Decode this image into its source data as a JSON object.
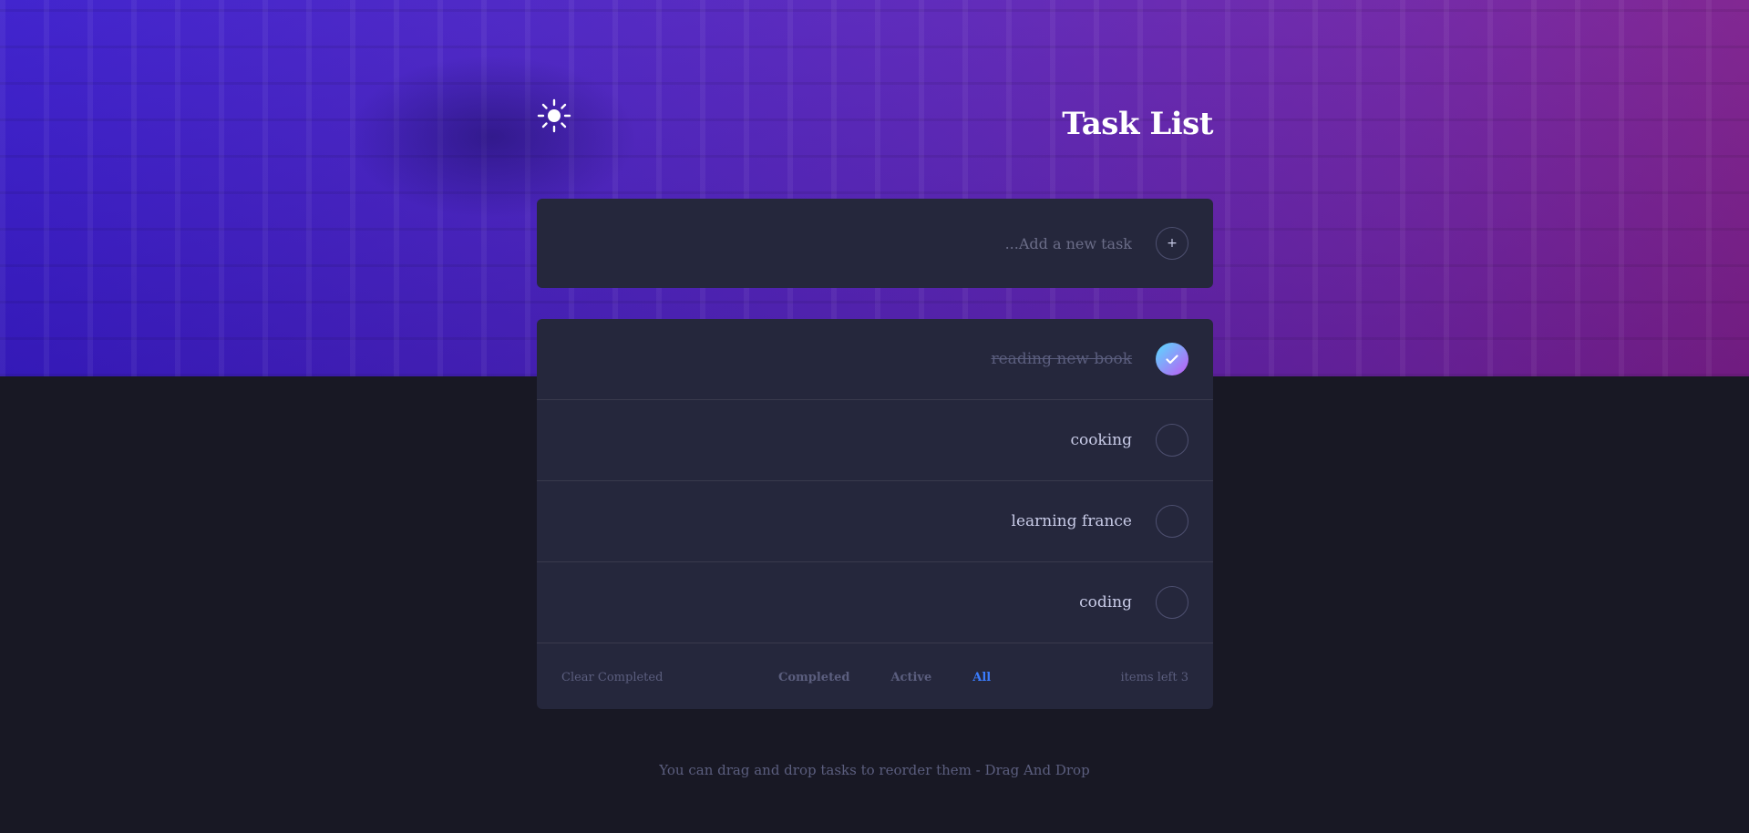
{
  "header": {
    "title": "Task List",
    "theme_icon": "sun-icon"
  },
  "new_task": {
    "placeholder": "...Add a new task",
    "value": "",
    "add_icon": "+"
  },
  "tasks": [
    {
      "label": "reading new book",
      "completed": true
    },
    {
      "label": "cooking",
      "completed": false
    },
    {
      "label": "learning france",
      "completed": false
    },
    {
      "label": "coding",
      "completed": false
    }
  ],
  "footer": {
    "clear_label": "Clear Completed",
    "filters": [
      "Completed",
      "Active",
      "All"
    ],
    "active_filter": "All",
    "items_left": "items left 3"
  },
  "hint": "You can drag and drop tasks to reorder them - Drag And Drop",
  "colors": {
    "accent": "#3a7cfd",
    "card": "#25273c",
    "background": "#181824",
    "check_gradient_start": "#57ddff",
    "check_gradient_end": "#c058f3"
  }
}
